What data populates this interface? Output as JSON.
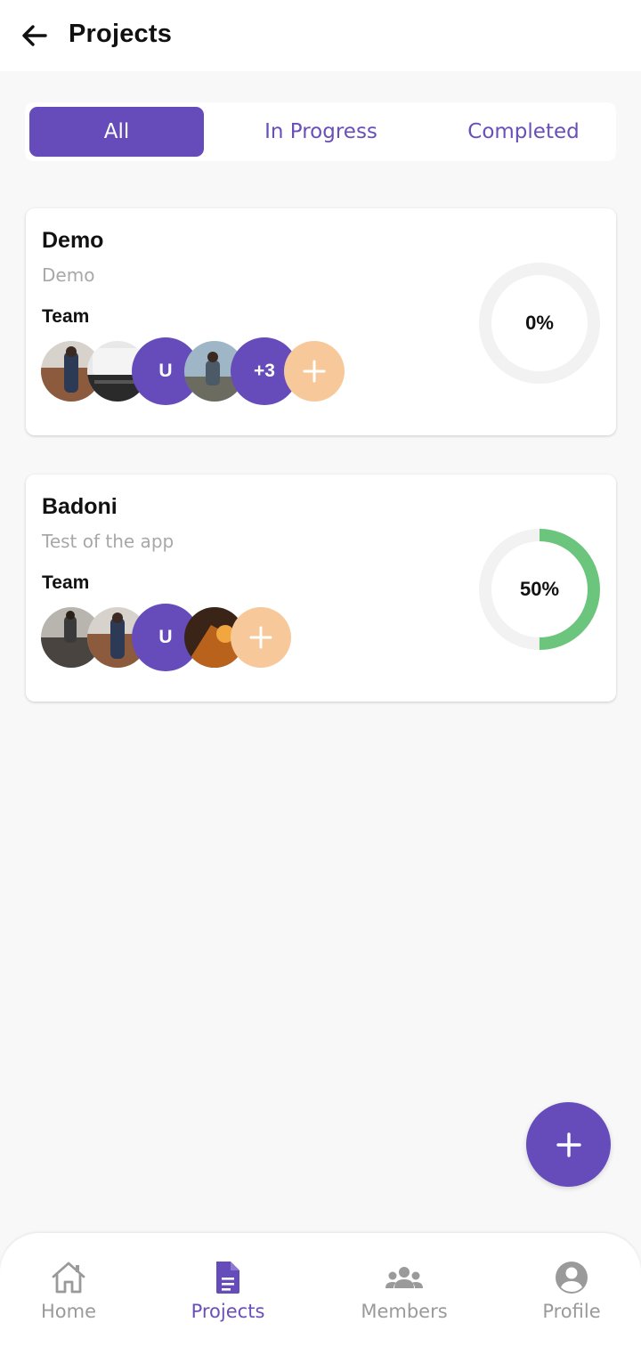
{
  "header": {
    "title": "Projects",
    "back_icon": "arrow-left-icon"
  },
  "tabs": [
    {
      "label": "All",
      "active": true
    },
    {
      "label": "In Progress",
      "active": false
    },
    {
      "label": "Completed",
      "active": false
    }
  ],
  "projects": [
    {
      "name": "Demo",
      "description": "Demo",
      "team_label": "Team",
      "members": [
        "photo",
        "photo",
        "U",
        "photo",
        "+3"
      ],
      "progress_label": "0%",
      "progress": 0
    },
    {
      "name": "Badoni",
      "description": "Test of the app",
      "team_label": "Team",
      "members": [
        "photo",
        "photo",
        "U",
        "photo"
      ],
      "progress_label": "50%",
      "progress": 0.5
    }
  ],
  "fab": {
    "icon": "plus-icon"
  },
  "bottom_nav": [
    {
      "label": "Home",
      "icon": "home-icon",
      "active": false
    },
    {
      "label": "Projects",
      "icon": "document-icon",
      "active": true
    },
    {
      "label": "Members",
      "icon": "group-icon",
      "active": false
    },
    {
      "label": "Profile",
      "icon": "account-circle-icon",
      "active": false
    }
  ],
  "colors": {
    "accent": "#664cba",
    "add_member": "#f7c99a",
    "progress": "#6cc57d",
    "progress_track": "#f2f2f2"
  }
}
